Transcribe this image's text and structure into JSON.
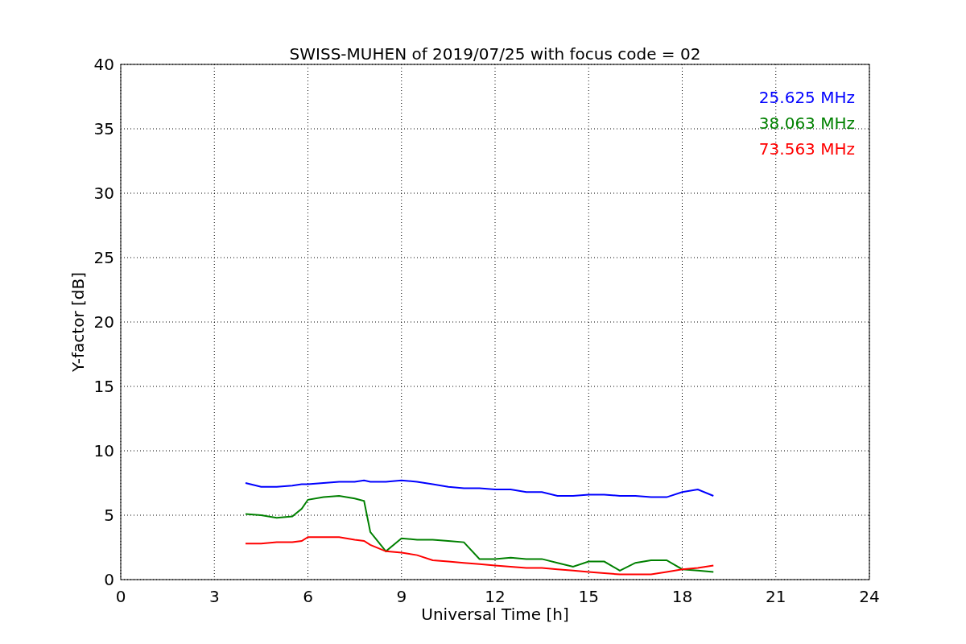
{
  "chart_data": {
    "type": "line",
    "title": "SWISS-MUHEN of 2019/07/25 with focus code = 02",
    "xlabel": "Universal Time [h]",
    "ylabel": "Y-factor [dB]",
    "x": [
      4,
      4.5,
      5,
      5.5,
      5.8,
      6,
      6.5,
      7,
      7.5,
      7.8,
      8,
      8.5,
      9,
      9.5,
      10,
      10.5,
      11,
      11.5,
      12,
      12.5,
      13,
      13.5,
      14,
      14.5,
      15,
      15.5,
      16,
      16.5,
      17,
      17.5,
      18,
      18.5,
      19
    ],
    "series": [
      {
        "name": "25.625 MHz",
        "color": "#0000ff",
        "values": [
          7.5,
          7.2,
          7.2,
          7.3,
          7.4,
          7.4,
          7.5,
          7.6,
          7.6,
          7.7,
          7.6,
          7.6,
          7.7,
          7.6,
          7.4,
          7.2,
          7.1,
          7.1,
          7.0,
          7.0,
          6.8,
          6.8,
          6.5,
          6.5,
          6.6,
          6.6,
          6.5,
          6.5,
          6.4,
          6.4,
          6.8,
          7.0,
          6.5
        ]
      },
      {
        "name": "38.063 MHz",
        "color": "#008000",
        "values": [
          5.1,
          5.0,
          4.8,
          4.9,
          5.5,
          6.2,
          6.4,
          6.5,
          6.3,
          6.1,
          3.7,
          2.2,
          3.2,
          3.1,
          3.1,
          3.0,
          2.9,
          1.6,
          1.6,
          1.7,
          1.6,
          1.6,
          1.3,
          1.0,
          1.4,
          1.4,
          0.7,
          1.3,
          1.5,
          1.5,
          0.8,
          0.7,
          0.6
        ]
      },
      {
        "name": "73.563 MHz",
        "color": "#ff0000",
        "values": [
          2.8,
          2.8,
          2.9,
          2.9,
          3.0,
          3.3,
          3.3,
          3.3,
          3.1,
          3.0,
          2.7,
          2.2,
          2.1,
          1.9,
          1.5,
          1.4,
          1.3,
          1.2,
          1.1,
          1.0,
          0.9,
          0.9,
          0.8,
          0.7,
          0.6,
          0.5,
          0.4,
          0.4,
          0.4,
          0.6,
          0.8,
          0.9,
          1.1
        ]
      }
    ],
    "xlim": [
      0,
      24
    ],
    "ylim": [
      0,
      40
    ],
    "xticks": [
      0,
      3,
      6,
      9,
      12,
      15,
      18,
      21,
      24
    ],
    "yticks": [
      0,
      5,
      10,
      15,
      20,
      25,
      30,
      35,
      40
    ],
    "grid": true
  }
}
